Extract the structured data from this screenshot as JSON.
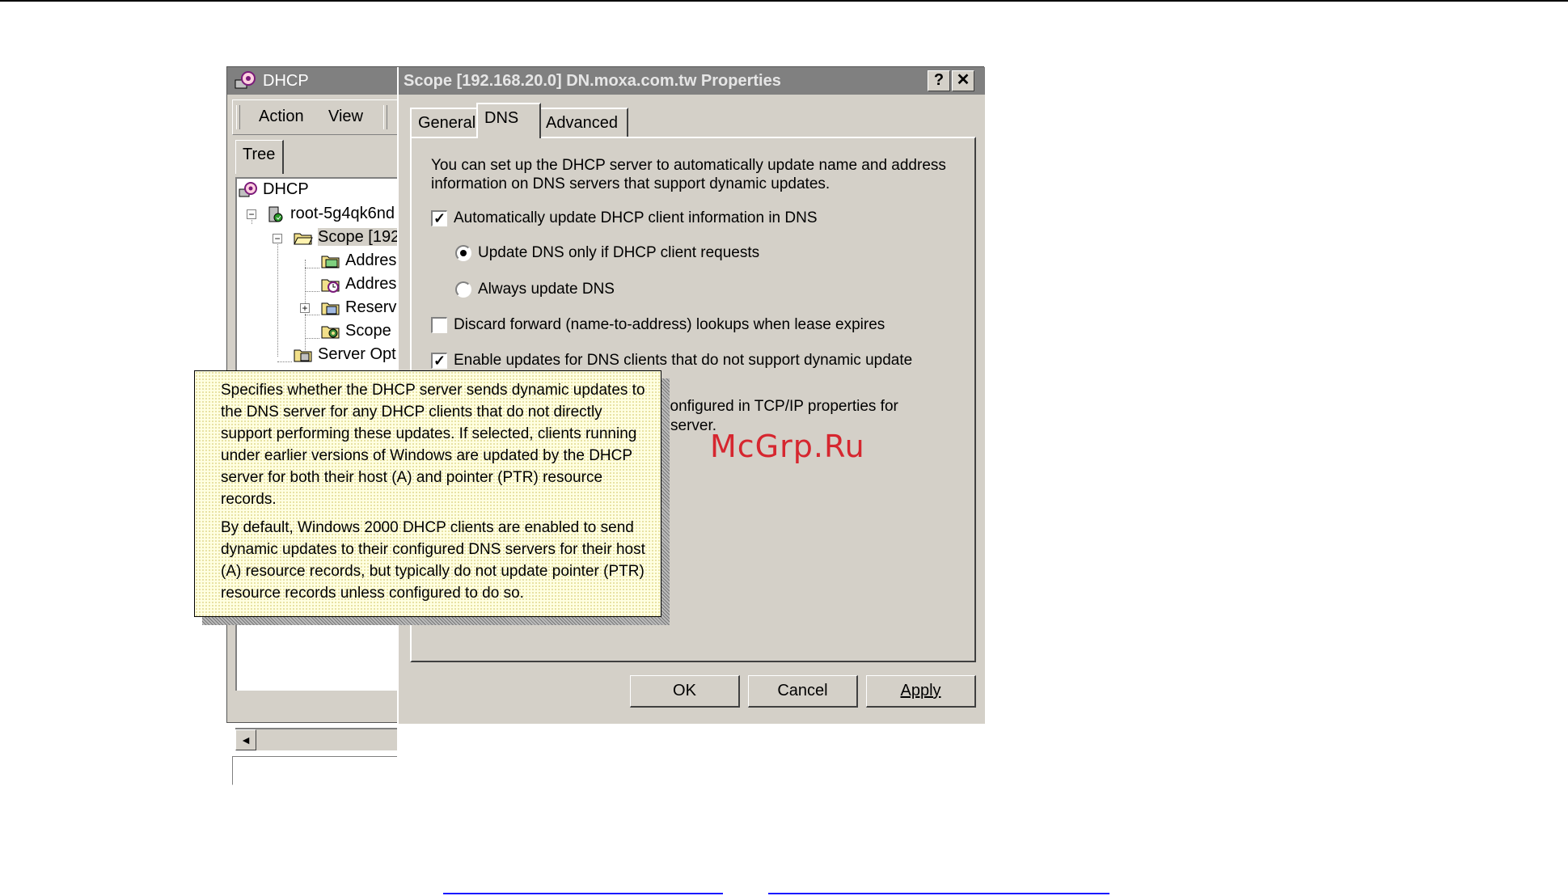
{
  "mmc": {
    "title": "DHCP",
    "menu": {
      "action": "Action",
      "view": "View"
    },
    "tree_tab": "Tree",
    "tree": [
      {
        "label": "DHCP"
      },
      {
        "label": "root-5g4qk6nd"
      },
      {
        "label": "Scope [192"
      },
      {
        "label": "Addres"
      },
      {
        "label": "Addres"
      },
      {
        "label": "Reserv"
      },
      {
        "label": "Scope"
      },
      {
        "label": "Server Opt"
      }
    ],
    "scroll_left": "◄"
  },
  "dialog": {
    "title": "Scope [192.168.20.0] DN.moxa.com.tw Properties",
    "help_btn": "?",
    "close_btn": "✕",
    "tabs": [
      "General",
      "DNS",
      "Advanced"
    ],
    "active_tab": "DNS",
    "description": "You can set up the DHCP server to automatically update name and address information on DNS servers that support dynamic updates.",
    "auto_update": {
      "label": "Automatically update DHCP client information in DNS",
      "checked": true
    },
    "radio_request": {
      "label": "Update DNS only if DHCP client requests",
      "selected": true
    },
    "radio_always": {
      "label": "Always update DNS",
      "selected": false
    },
    "discard": {
      "label": "Discard forward (name-to-address) lookups when lease expires",
      "checked": false
    },
    "enable_updates": {
      "label": "Enable updates for DNS clients that do not support dynamic update",
      "checked": true
    },
    "obscured_line1": "configured in TCP/IP properties for",
    "obscured_line2": "server.",
    "buttons": {
      "ok": "OK",
      "cancel": "Cancel",
      "apply": "Apply"
    }
  },
  "popup": {
    "para1": "Specifies whether the DHCP server sends dynamic updates to the DNS server for any DHCP clients that do not directly support performing these updates. If selected, clients running under earlier versions of Windows are updated by the DHCP server for both their host (A) and pointer (PTR) resource records.",
    "para2": "By default, Windows 2000 DHCP clients are enabled to send dynamic updates to their configured DNS servers for their host (A) resource records, but typically do not update pointer (PTR) resource records unless configured to do so."
  },
  "watermark": "McGrp.Ru"
}
